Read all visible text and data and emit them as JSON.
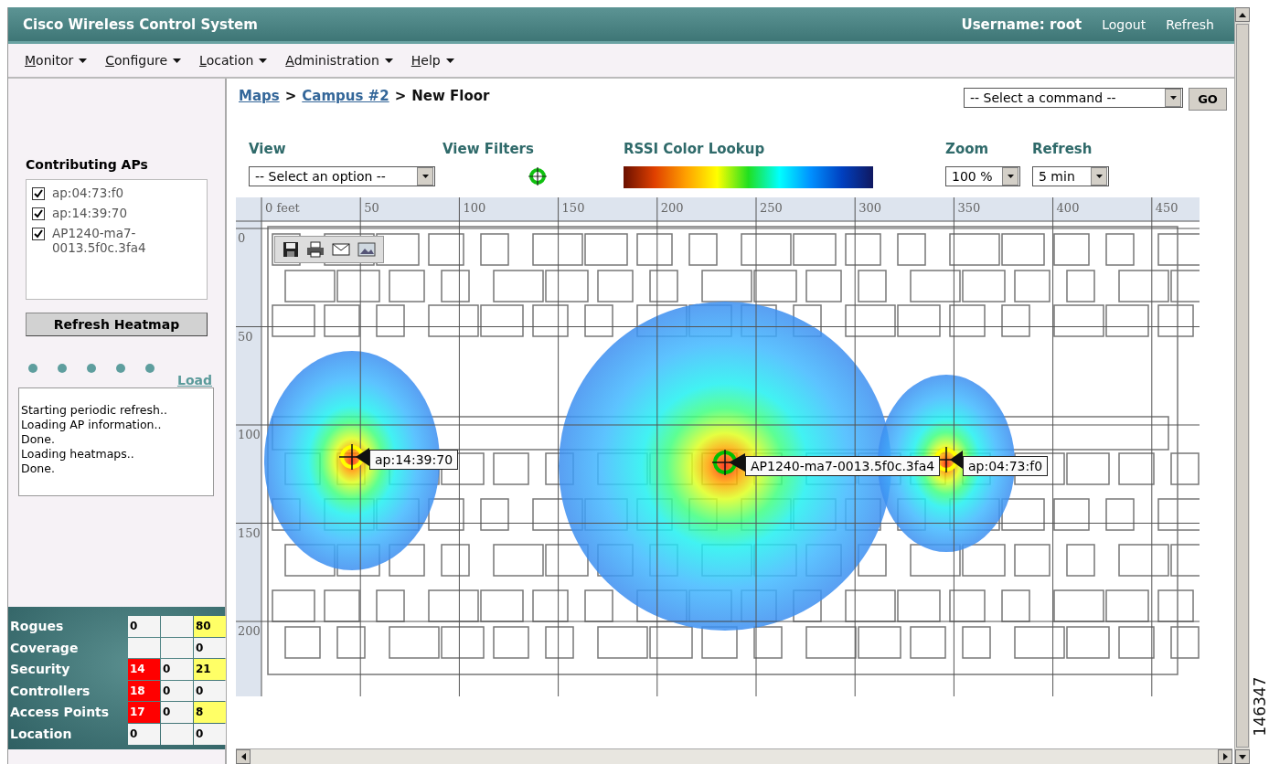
{
  "header": {
    "title": "Cisco Wireless Control System",
    "username": "Username: root",
    "links": [
      "Logout",
      "Refresh"
    ]
  },
  "menu": [
    {
      "label": "Monitor"
    },
    {
      "label": "Configure"
    },
    {
      "label": "Location"
    },
    {
      "label": "Administration"
    },
    {
      "label": "Help"
    }
  ],
  "sidebar": {
    "contributing_aps": {
      "title": "Contributing APs",
      "items": [
        {
          "label": "ap:04:73:f0",
          "checked": true
        },
        {
          "label": "ap:14:39:70",
          "checked": true
        },
        {
          "label": "AP1240-ma7-0013.5f0c.3fa4",
          "checked": true
        }
      ]
    },
    "refresh_button": "Refresh Heatmap",
    "load_link": "Load",
    "log": [
      "Starting periodic refresh..",
      "Loading AP information..",
      "Done.",
      "Loading heatmaps..",
      "Done."
    ]
  },
  "alarm_summary": [
    {
      "label": "Rogues",
      "cells": [
        {
          "text": "0",
          "color": "#f4f4f4"
        },
        {
          "text": "",
          "color": "#f4f4f4"
        },
        {
          "text": "80",
          "color": "#ffff66"
        }
      ]
    },
    {
      "label": "Coverage",
      "cells": [
        {
          "text": "",
          "color": "#f4f4f4"
        },
        {
          "text": "",
          "color": "#f4f4f4"
        },
        {
          "text": "0",
          "color": "#f4f4f4"
        }
      ]
    },
    {
      "label": "Security",
      "cells": [
        {
          "text": "14",
          "color": "#ff0000"
        },
        {
          "text": "0",
          "color": "#f4f4f4"
        },
        {
          "text": "21",
          "color": "#ffff66"
        }
      ]
    },
    {
      "label": "Controllers",
      "cells": [
        {
          "text": "18",
          "color": "#ff0000"
        },
        {
          "text": "0",
          "color": "#f4f4f4"
        },
        {
          "text": "0",
          "color": "#f4f4f4"
        }
      ]
    },
    {
      "label": "Access Points",
      "cells": [
        {
          "text": "17",
          "color": "#ff0000"
        },
        {
          "text": "0",
          "color": "#f4f4f4"
        },
        {
          "text": "8",
          "color": "#ffff66"
        }
      ]
    },
    {
      "label": "Location",
      "cells": [
        {
          "text": "0",
          "color": "#f4f4f4"
        },
        {
          "text": "",
          "color": "#f4f4f4"
        },
        {
          "text": "0",
          "color": "#f4f4f4"
        }
      ]
    }
  ],
  "breadcrumb": [
    {
      "label": "Maps",
      "link": true
    },
    {
      "label": "Campus #2",
      "link": true
    },
    {
      "label": "New Floor",
      "link": false
    }
  ],
  "breadcrumb_separator": ">",
  "command": {
    "value": "-- Select a command --",
    "button": "GO"
  },
  "controls": {
    "view": {
      "label": "View",
      "value": "-- Select an option --"
    },
    "view_filters": {
      "label": "View Filters"
    },
    "rssi": {
      "label": "RSSI Color Lookup"
    },
    "zoom": {
      "label": "Zoom",
      "value": "100 %"
    },
    "refresh": {
      "label": "Refresh",
      "value": "5 min"
    }
  },
  "map": {
    "x_ticks": [
      "0 feet",
      "50",
      "100",
      "150",
      "200",
      "250",
      "300",
      "350",
      "400",
      "450"
    ],
    "y_ticks": [
      "0",
      "50",
      "100",
      "150",
      "200"
    ],
    "aps": [
      {
        "label": "ap:14:39:70",
        "color": "#ffff00"
      },
      {
        "label": "AP1240-ma7-0013.5f0c.3fa4",
        "color": "#00c000"
      },
      {
        "label": "ap:04:73:f0",
        "color": "#ffff00"
      }
    ]
  },
  "figure_number": "146347"
}
